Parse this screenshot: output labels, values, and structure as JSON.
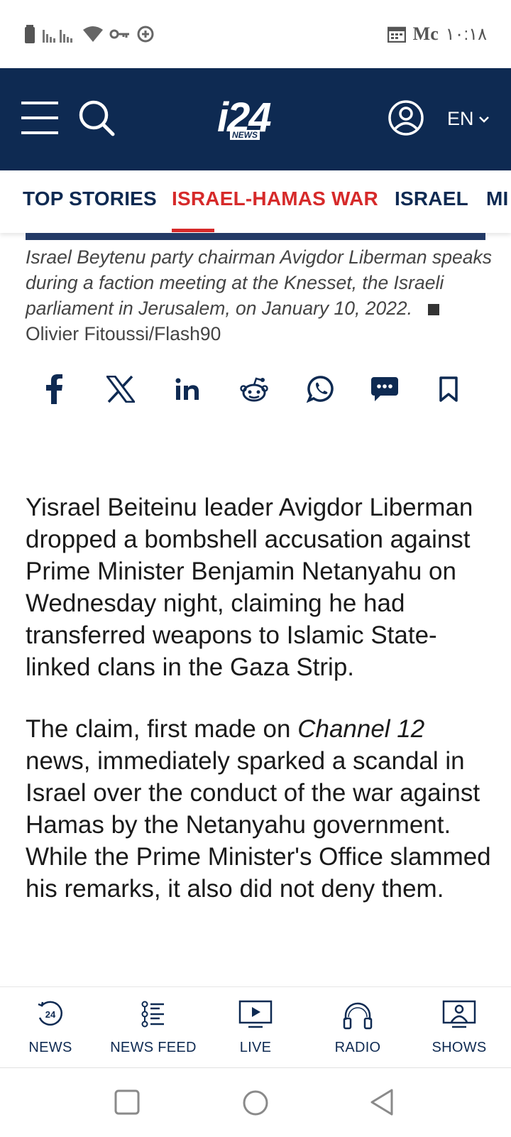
{
  "status_bar": {
    "carrier": "Mc",
    "time": "١٠:١٨"
  },
  "header": {
    "logo_text": "i24",
    "logo_subtext": "NEWS",
    "language": "EN"
  },
  "tabs": [
    {
      "label": "TOP STORIES"
    },
    {
      "label": "ISRAEL-HAMAS WAR"
    },
    {
      "label": "ISRAEL"
    },
    {
      "label": "MI"
    }
  ],
  "caption": {
    "text": "Israel Beytenu party chairman Avigdor Liberman speaks during a faction meeting at the Knesset, the Israeli parliament in Jerusalem, on January 10, 2022.",
    "credit": "Olivier Fitoussi/Flash90"
  },
  "article": {
    "p1": "Yisrael Beiteinu leader Avigdor Liberman dropped a bombshell accusation against Prime Minister Benjamin Netanyahu on Wednesday night, claiming he had transferred weapons to Islamic State-linked clans in the Gaza Strip.",
    "p2_start": "The claim, first made on ",
    "p2_em": "Channel 12",
    "p2_end": " news, immediately sparked a scandal in Israel over the conduct of the war against Hamas by the Netanyahu government. While the Prime Minister's Office slammed his remarks, it also did not deny them."
  },
  "bottom_nav": [
    {
      "label": "NEWS",
      "icon": "news-24-icon"
    },
    {
      "label": "NEWS FEED",
      "icon": "list-icon"
    },
    {
      "label": "LIVE",
      "icon": "tv-play-icon"
    },
    {
      "label": "RADIO",
      "icon": "headphones-icon"
    },
    {
      "label": "SHOWS",
      "icon": "shows-icon"
    }
  ],
  "colors": {
    "brand_navy": "#0e2a52",
    "accent_red": "#d62a2a"
  }
}
